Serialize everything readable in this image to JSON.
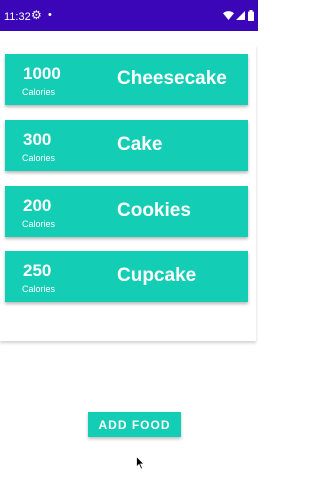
{
  "status_bar": {
    "time": "11:32",
    "icons": [
      "gear-icon",
      "dot-icon",
      "wifi-icon",
      "signal-icon",
      "battery-icon"
    ],
    "background": "#3a06b8"
  },
  "accent_color": "#13cdb5",
  "foods": [
    {
      "calories": "1000",
      "unit": "Calories",
      "name": "Cheesecake"
    },
    {
      "calories": "300",
      "unit": "Calories",
      "name": "Cake"
    },
    {
      "calories": "200",
      "unit": "Calories",
      "name": "Cookies"
    },
    {
      "calories": "250",
      "unit": "Calories",
      "name": "Cupcake"
    }
  ],
  "add_button_label": "ADD FOOD"
}
